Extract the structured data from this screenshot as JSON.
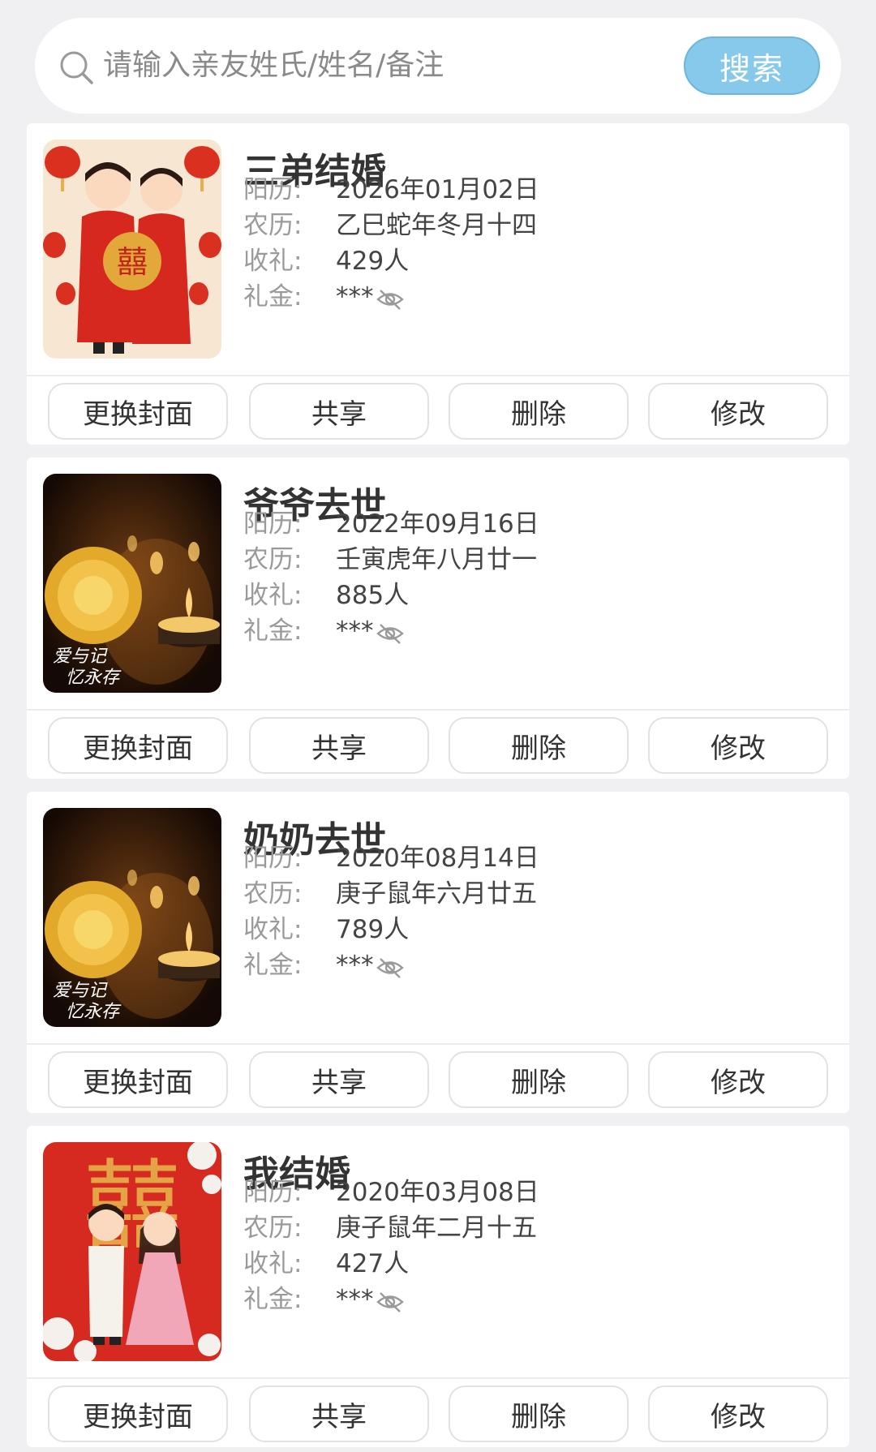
{
  "search": {
    "placeholder": "请输入亲友姓氏/姓名/备注",
    "button_label": "搜索"
  },
  "labels": {
    "solar": "阳历:",
    "lunar": "农历:",
    "guests": "收礼:",
    "money": "礼金:"
  },
  "actions": {
    "change_cover": "更换封面",
    "share": "共享",
    "delete": "删除",
    "edit": "修改"
  },
  "events": [
    {
      "title": "三弟结婚",
      "solar": "2026年01月02日",
      "lunar": "乙巳蛇年冬月十四",
      "guests": "429人",
      "money": "***",
      "cover": "wedding-traditional-image"
    },
    {
      "title": "爷爷去世",
      "solar": "2022年09月16日",
      "lunar": "壬寅虎年八月廿一",
      "guests": "885人",
      "money": "***",
      "cover": "memorial-candles-image",
      "cover_caption": [
        "爱与记",
        "忆永存"
      ]
    },
    {
      "title": "奶奶去世",
      "solar": "2020年08月14日",
      "lunar": "庚子鼠年六月廿五",
      "guests": "789人",
      "money": "***",
      "cover": "memorial-candles-image",
      "cover_caption": [
        "爱与记",
        "忆永存"
      ]
    },
    {
      "title": "我结婚",
      "solar": "2020年03月08日",
      "lunar": "庚子鼠年二月十五",
      "guests": "427人",
      "money": "***",
      "cover": "wedding-western-image"
    }
  ],
  "colors": {
    "search_button": "#86c9ea",
    "wedding_red": "#d62a21",
    "memorial_dark": "#1a0d05"
  }
}
